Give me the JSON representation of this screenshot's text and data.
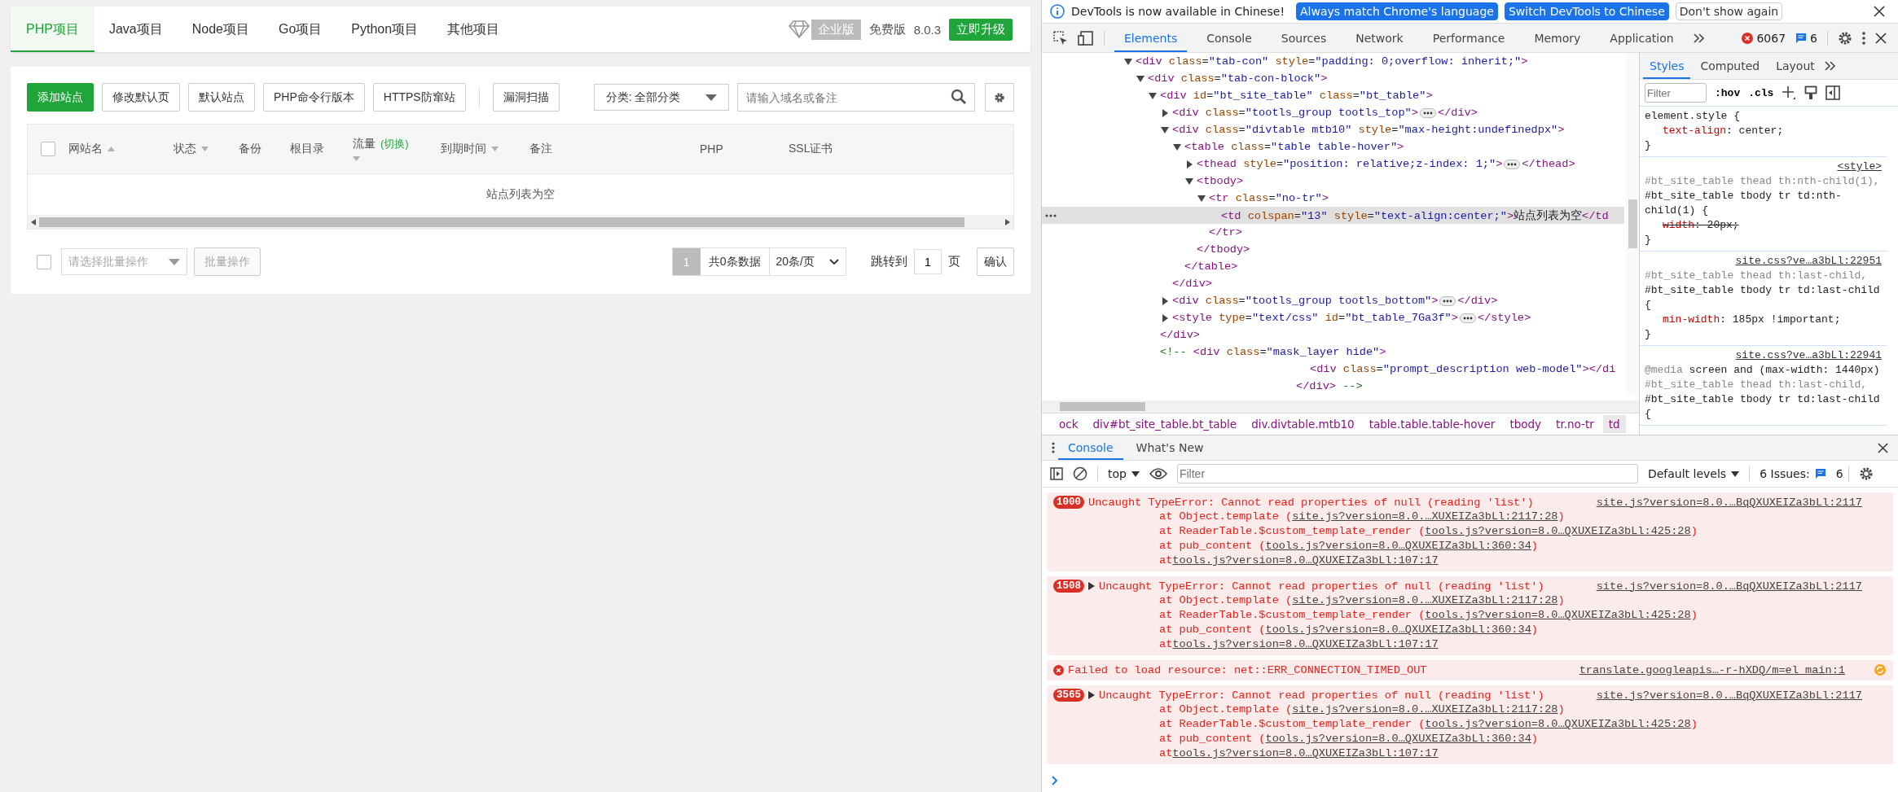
{
  "panel": {
    "tabs": [
      {
        "label": "PHP项目",
        "selected": true
      },
      {
        "label": "Java项目",
        "selected": false
      },
      {
        "label": "Node项目",
        "selected": false
      },
      {
        "label": "Go项目",
        "selected": false
      },
      {
        "label": "Python项目",
        "selected": false
      },
      {
        "label": "其他项目",
        "selected": false
      }
    ],
    "edition": {
      "badge": "企业版",
      "plan": "免费版",
      "version": "8.0.3",
      "upgrade": "立即升级"
    },
    "toolbar": [
      {
        "label": "添加站点",
        "kind": "primary"
      },
      {
        "label": "修改默认页",
        "kind": "default"
      },
      {
        "label": "默认站点",
        "kind": "default"
      },
      {
        "label": "PHP命令行版本",
        "kind": "default"
      },
      {
        "label": "HTTPS防窜站",
        "kind": "default"
      },
      {
        "kind": "divider"
      },
      {
        "label": "漏洞扫描",
        "kind": "default"
      }
    ],
    "category": "分类: 全部分类",
    "search": {
      "placeholder": "请输入域名或备注"
    },
    "table": {
      "select_all_checked": false,
      "columns": [
        {
          "label": "网站名",
          "sortable": true,
          "ascending": true
        },
        {
          "label": "状态",
          "sortable": true,
          "ascending": false
        },
        {
          "label": "备份",
          "sortable": false
        },
        {
          "label": "根目录",
          "sortable": false
        },
        {
          "label": "流量",
          "extra": "(切换)",
          "sortable": true,
          "ascending": false
        },
        {
          "label": "到期时间",
          "sortable": true,
          "ascending": false
        },
        {
          "label": "备注",
          "sortable": false
        },
        {
          "label": "PHP",
          "sortable": false
        },
        {
          "label": "SSL证书",
          "sortable": false
        }
      ],
      "empty": "站点列表为空"
    },
    "footer": {
      "checked": false,
      "batch_placeholder": "请选择批量操作",
      "batch_button": {
        "label": "批量操作",
        "disabled": true
      },
      "pages": [
        {
          "label": "1",
          "selected": true
        }
      ],
      "total": "共0条数据",
      "page_size": "20条/页",
      "jump_label": "跳转到",
      "jump_value": "1",
      "page_unit": "页",
      "confirm": "确认"
    }
  },
  "devtools": {
    "infobar": {
      "message": "DevTools is now available in Chinese!",
      "buttons": [
        {
          "label": "Always match Chrome's language",
          "kind": "primary"
        },
        {
          "label": "Switch DevTools to Chinese",
          "kind": "primary"
        },
        {
          "label": "Don't show again",
          "kind": "default"
        }
      ]
    },
    "tabs": [
      {
        "label": "Elements",
        "selected": true
      },
      {
        "label": "Console",
        "selected": false
      },
      {
        "label": "Sources",
        "selected": false
      },
      {
        "label": "Network",
        "selected": false
      },
      {
        "label": "Performance",
        "selected": false
      },
      {
        "label": "Memory",
        "selected": false
      },
      {
        "label": "Application",
        "selected": false
      }
    ],
    "error_count": "6067",
    "message_count": "6",
    "dom": [
      {
        "kind": "element",
        "open": "<div class=\"tab-con\" style=\"padding: 0;overflow: inherit;\">",
        "expanded": true,
        "selected": false,
        "children": [
          {
            "kind": "element",
            "open": "<div class=\"tab-con-block\">",
            "expanded": true,
            "selected": false,
            "children": [
              {
                "kind": "element",
                "open": "<div id=\"bt_site_table\" class=\"bt_table\">",
                "expanded": true,
                "selected": false,
                "children": [
                  {
                    "kind": "element",
                    "open": "<div class=\"tootls_group tootls_top\">",
                    "close": "</div>",
                    "expanded": false,
                    "selected": false
                  },
                  {
                    "kind": "element",
                    "open": "<div class=\"divtable mtb10\" style=\"max-height:undefinedpx\">",
                    "close": "</div>",
                    "expanded": true,
                    "selected": false,
                    "children": [
                      {
                        "kind": "element",
                        "open": "<table class=\"table table-hover\">",
                        "close": "</table>",
                        "expanded": true,
                        "selected": false,
                        "children": [
                          {
                            "kind": "element",
                            "open": "<thead style=\"position: relative;z-index: 1;\">",
                            "close": "</thead>",
                            "expanded": false,
                            "selected": false
                          },
                          {
                            "kind": "element",
                            "open": "<tbody>",
                            "close": "</tbody>",
                            "expanded": true,
                            "selected": false,
                            "children": [
                              {
                                "kind": "element",
                                "open": "<tr class=\"no-tr\">",
                                "close": "</tr>",
                                "expanded": true,
                                "selected": false,
                                "children": [
                                  {
                                    "kind": "leaf",
                                    "open": "<td colspan=\"13\" style=\"text-align:center;\">站点列表为空</td",
                                    "selected": true
                                  }
                                ]
                              }
                            ]
                          }
                        ]
                      }
                    ]
                  },
                  {
                    "kind": "element",
                    "open": "<div class=\"tootls_group tootls_bottom\">",
                    "close": "</div>",
                    "expanded": false,
                    "selected": false
                  },
                  {
                    "kind": "element",
                    "open": "<style type=\"text/css\" id=\"bt_table_7Ga3f\">",
                    "close": "</style>",
                    "expanded": false,
                    "selected": false
                  }
                ],
                "close": "</div>"
              },
              {
                "kind": "comment",
                "selected": false,
                "lines": [
                  "<!-- <div class=\"mask_layer hide\">",
                  "<div class=\"prompt_description web-model\"></di",
                  "</div> -->"
                ]
              }
            ]
          }
        ]
      }
    ],
    "breadcrumbs": [
      {
        "label": "ock",
        "selected": false
      },
      {
        "label": "div#bt_site_table.bt_table",
        "selected": false
      },
      {
        "label": "div.divtable.mtb10",
        "selected": false
      },
      {
        "label": "table.table.table-hover",
        "selected": false
      },
      {
        "label": "tbody",
        "selected": false
      },
      {
        "label": "tr.no-tr",
        "selected": false
      },
      {
        "label": "td",
        "selected": true
      }
    ],
    "styles": {
      "tabs": [
        {
          "label": "Styles",
          "selected": true
        },
        {
          "label": "Computed",
          "selected": false
        },
        {
          "label": "Layout",
          "selected": false
        }
      ],
      "filter_placeholder": "Filter",
      "hov": ":hov",
      "cls": ".cls",
      "rules": [
        {
          "selector": "element.style {",
          "decls": [
            {
              "prop": "text-align",
              "sep": ":",
              "value": "center;",
              "struck": false
            }
          ],
          "end": "}"
        },
        {
          "source": "<style>",
          "dim": "#bt_site_table thead th:nth-child(1),",
          "selector": "#bt_site_table tbody tr td:nth-child(1) {",
          "decls": [
            {
              "prop": "width",
              "sep": ":",
              "value": "20px;",
              "struck": true
            }
          ],
          "end": "}"
        },
        {
          "source": "site.css?ve…a3bLl:22951",
          "dim": "#bt_site_table thead th:last-child,",
          "selector": "#bt_site_table tbody tr td:last-child {",
          "decls": [
            {
              "prop": "min-width",
              "sep": ":",
              "value": "185px !important;",
              "struck": false
            }
          ],
          "end": "}"
        },
        {
          "media_keyword": "@media",
          "media": "screen and (max-width: 1440px)",
          "source": "site.css?ve…a3bLl:22941",
          "dim": "#bt_site_table thead th:last-child,",
          "selector": "#bt_site_table tbody tr td:last-child {"
        }
      ]
    },
    "drawer_tabs": [
      {
        "label": "Console",
        "selected": true
      },
      {
        "label": "What's New",
        "selected": false
      }
    ],
    "console_toolbar": {
      "context": "top",
      "filter_placeholder": "Filter",
      "levels": "Default levels",
      "issues": "6 Issues:",
      "issues_count": "6"
    },
    "messages": [
      {
        "kind": "group",
        "count": "1000",
        "toggle": false,
        "text": "Uncaught TypeError: Cannot read properties of null (reading 'list')",
        "source": "site.js?version=8.0.…BqQXUXEIZa3bLl:2117",
        "stack": [
          {
            "prefix": "at Object.template (",
            "link": "site.js?version=8.0.…XUXEIZa3bLl:2117:28",
            "suffix": ")"
          },
          {
            "prefix": "at ReaderTable.$custom_template_render (",
            "link": "tools.js?version=8.0…QXUXEIZa3bLl:425:28",
            "suffix": ")"
          },
          {
            "prefix": "at pub_content (",
            "link": "tools.js?version=8.0…QXUXEIZa3bLl:360:34",
            "suffix": ")"
          },
          {
            "prefix": "at",
            "link": "tools.js?version=8.0…QXUXEIZa3bLl:107:17"
          }
        ]
      },
      {
        "kind": "group",
        "count": "1508",
        "toggle": true,
        "text": "Uncaught TypeError: Cannot read properties of null (reading 'list')",
        "source": "site.js?version=8.0.…BqQXUXEIZa3bLl:2117",
        "stack": [
          {
            "prefix": "at Object.template (",
            "link": "site.js?version=8.0.…XUXEIZa3bLl:2117:28",
            "suffix": ")"
          },
          {
            "prefix": "at ReaderTable.$custom_template_render (",
            "link": "tools.js?version=8.0…QXUXEIZa3bLl:425:28",
            "suffix": ")"
          },
          {
            "prefix": "at pub_content (",
            "link": "tools.js?version=8.0…QXUXEIZa3bLl:360:34",
            "suffix": ")"
          },
          {
            "prefix": "at",
            "link": "tools.js?version=8.0…QXUXEIZa3bLl:107:17"
          }
        ]
      },
      {
        "kind": "error",
        "text": "Failed to load resource: net::ERR_CONNECTION_TIMED_OUT",
        "source": "translate.googleapis…-r-hXDQ/m=el_main:1"
      },
      {
        "kind": "group",
        "count": "3565",
        "toggle": true,
        "text": "Uncaught TypeError: Cannot read properties of null (reading 'list')",
        "source": "site.js?version=8.0.…BqQXUXEIZa3bLl:2117",
        "stack": [
          {
            "prefix": "at Object.template (",
            "link": "site.js?version=8.0.…XUXEIZa3bLl:2117:28",
            "suffix": ")"
          },
          {
            "prefix": "at ReaderTable.$custom_template_render (",
            "link": "tools.js?version=8.0…QXUXEIZa3bLl:425:28",
            "suffix": ")"
          },
          {
            "prefix": "at pub_content (",
            "link": "tools.js?version=8.0…QXUXEIZa3bLl:360:34",
            "suffix": ")"
          },
          {
            "prefix": "at",
            "link": "tools.js?version=8.0…QXUXEIZa3bLl:107:17"
          }
        ]
      }
    ]
  }
}
